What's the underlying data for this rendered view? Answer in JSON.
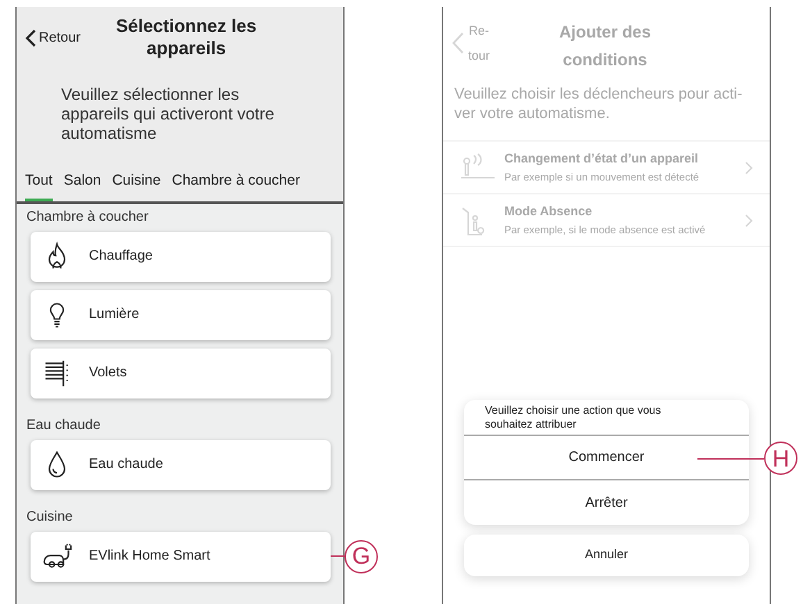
{
  "left_screen": {
    "back_label": "Retour",
    "title": "Sélectionnez les appareils",
    "description": "Veuillez sélectionner les appareils qui activeront votre automatisme",
    "tabs": [
      {
        "label": "Tout",
        "selected": true
      },
      {
        "label": "Salon",
        "selected": false
      },
      {
        "label": "Cuisine",
        "selected": false
      },
      {
        "label": "Chambre à coucher",
        "selected": false
      }
    ],
    "groups": [
      {
        "heading": "Chambre à coucher",
        "devices": [
          {
            "kind": "flame",
            "name": "Chauffage"
          },
          {
            "kind": "bulb",
            "name": "Lumière"
          },
          {
            "kind": "blinds",
            "name": "Volets"
          }
        ]
      },
      {
        "heading": "Eau chaude",
        "devices": [
          {
            "kind": "drop",
            "name": "Eau chaude"
          }
        ]
      },
      {
        "heading": "Cuisine",
        "devices": [
          {
            "kind": "charger",
            "name": "EVlink Home Smart"
          }
        ]
      }
    ],
    "callout": "G"
  },
  "right_screen": {
    "back_label_lines": [
      "Re-",
      "tour"
    ],
    "title": "Ajouter des conditions",
    "description": "Veuillez choisir les déclencheurs pour acti-ver votre automatisme.",
    "conditions": [
      {
        "kind": "device",
        "title": "Changement d’état d’un appareil",
        "subtitle": "Par exemple si un mouvement est détecté"
      },
      {
        "kind": "absence",
        "title": "Mode Absence",
        "subtitle": "Par exemple, si le mode absence est activé"
      }
    ],
    "action_sheet": {
      "prompt": "Veuillez choisir une action que vous souhaitez attribuer",
      "actions": [
        "Commencer",
        "Arrêter"
      ],
      "cancel": "Annuler"
    },
    "callout": "H"
  }
}
